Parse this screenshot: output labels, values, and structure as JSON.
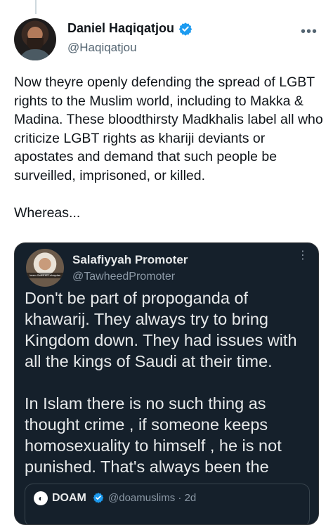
{
  "tweet": {
    "author_name": "Daniel Haqiqatjou",
    "author_handle": "@Haqiqatjou",
    "more_label": "•••",
    "text": "Now theyre openly defending the spread of LGBT rights to the Muslim world, including to Makka & Madina. These bloodthirsty Madkhalis label all who criticize LGBT rights as khariji deviants or apostates and demand that such people be surveilled, imprisoned, or killed.\n\nWhereas..."
  },
  "quote": {
    "author_name": "Salafiyyah Promoter",
    "author_handle": "@TawheedPromoter",
    "avatar_caption": "Imam Saleh Al Luhaydan",
    "more_label": "⋮",
    "text": "Don't be part of propoganda of khawarij. They always try to bring Kingdom down. They had issues with all the kings of Saudi at their time.\n\nIn Islam there is no such thing as thought crime , if someone keeps homosexuality to himself , he is not punished. That's always been the",
    "nested": {
      "author_name": "DOAM",
      "author_handle": "@doamuslims · 2d",
      "avatar_glyph": "◐"
    }
  },
  "colors": {
    "verified": "#1d9bf0",
    "quote_bg": "#15202b",
    "text_primary": "#0f1419",
    "text_secondary": "#536471"
  },
  "icons": [
    "verified-badge-icon",
    "more-options-icon"
  ]
}
